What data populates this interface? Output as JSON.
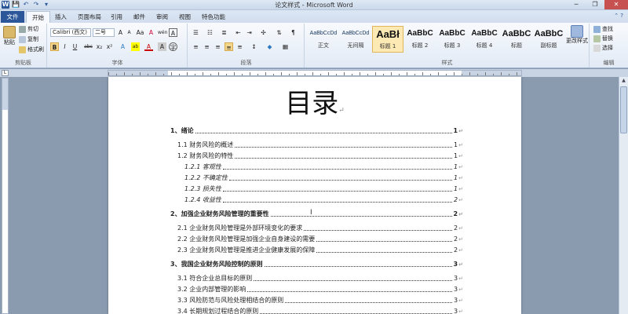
{
  "window": {
    "title": "论文样式 - Microsoft Word",
    "qat": [
      "W",
      "💾",
      "↶",
      "↷",
      "▾"
    ],
    "controls": [
      "─",
      "❐",
      "✕"
    ]
  },
  "tabs": [
    "文件",
    "开始",
    "插入",
    "页面布局",
    "引用",
    "邮件",
    "审阅",
    "视图",
    "特色功能"
  ],
  "ribbon": {
    "clipboard": {
      "label": "剪贴板",
      "paste": "粘贴",
      "cut": "剪切",
      "copy": "复制",
      "format_painter": "格式刷"
    },
    "font": {
      "label": "字体",
      "font_name": "Calibri (西文)",
      "font_size": "二号",
      "grow": "A",
      "shrink": "A",
      "case": "Aa",
      "clear": "A",
      "phonetic": "wén",
      "border": "A",
      "bold": "B",
      "italic": "I",
      "underline": "U",
      "strike": "abc",
      "sub": "x₂",
      "sup": "x²",
      "effects": "A",
      "highlight": "ab",
      "color": "A",
      "shade": "A",
      "circle": "字"
    },
    "paragraph": {
      "label": "段落"
    },
    "styles": {
      "label": "样式",
      "items": [
        {
          "sample": "AaBbCcDd",
          "name": "正文"
        },
        {
          "sample": "AaBbCcDd",
          "name": "无间隔"
        },
        {
          "sample": "AaBł",
          "name": "标题 1"
        },
        {
          "sample": "AaBbC",
          "name": "标题 2"
        },
        {
          "sample": "AaBbC",
          "name": "标题 3"
        },
        {
          "sample": "AaBbC",
          "name": "标题 4"
        },
        {
          "sample": "AaBbC",
          "name": "标题"
        },
        {
          "sample": "AaBbC",
          "name": "副标题"
        }
      ],
      "change_styles": "更改样式"
    },
    "editing": {
      "label": "编辑",
      "find": "查找",
      "replace": "替换",
      "select": "选择"
    }
  },
  "document": {
    "title": "目录",
    "toc": [
      {
        "level": 1,
        "text": "1、绪论",
        "page": "1"
      },
      {
        "level": 2,
        "text": "1.1 财务风险的概述",
        "page": "1"
      },
      {
        "level": 2,
        "text": "1.2 财务风险的特性",
        "page": "1"
      },
      {
        "level": 3,
        "text": "1.2.1 客观性",
        "page": "1"
      },
      {
        "level": 3,
        "text": "1.2.2 不确定性",
        "page": "1"
      },
      {
        "level": 3,
        "text": "1.2.3 损失性",
        "page": "1"
      },
      {
        "level": 3,
        "text": "1.2.4 收益性",
        "page": "2"
      },
      {
        "level": 1,
        "text": "2、加强企业财务风险管理的重要性",
        "page": "2"
      },
      {
        "level": 2,
        "text": "2.1 企业财务风险管理是外部环境变化的要求",
        "page": "2"
      },
      {
        "level": 2,
        "text": "2.2 企业财务风险管理是加强企业自身建设的需要",
        "page": "2"
      },
      {
        "level": 2,
        "text": "2.3 企业财务风险管理是推进企业健康发展的保障",
        "page": "2"
      },
      {
        "level": 1,
        "text": "3、我国企业财务风险控制的原则",
        "page": "3"
      },
      {
        "level": 2,
        "text": "3.1 符合企业总目标的原则",
        "page": "3"
      },
      {
        "level": 2,
        "text": "3.2 企业内部管理的影响",
        "page": "3"
      },
      {
        "level": 2,
        "text": "3.3 风险防范与风险处理相结合的原则",
        "page": "3"
      },
      {
        "level": 2,
        "text": "3.4 长期规划过程结合的原则",
        "page": "3"
      }
    ],
    "para_mark": "↵"
  },
  "colors": {
    "accent": "#2b579a",
    "ribbon_bg": "#e2eaf5",
    "workspace": "#8a9bb0"
  }
}
